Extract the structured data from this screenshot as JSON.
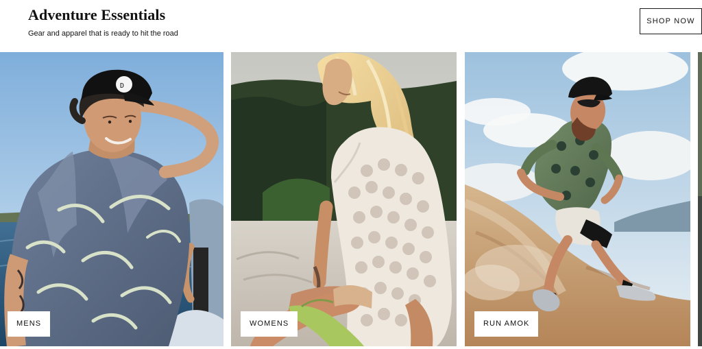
{
  "header": {
    "title": "Adventure Essentials",
    "subtitle": "Gear and apparel that is ready to hit the road",
    "cta_label": "SHOP NOW"
  },
  "cards": [
    {
      "label": "MENS"
    },
    {
      "label": "WOMENS"
    },
    {
      "label": "RUN AMOK"
    }
  ],
  "colors": {
    "background": "#ffffff",
    "text": "#111111",
    "border": "#1a1a1a",
    "sky_mens": "#8fb8df",
    "water": "#2f5f85",
    "foliage": "#2e3f25",
    "sand": "#c9a276",
    "sky_run": "#9fc1de"
  }
}
